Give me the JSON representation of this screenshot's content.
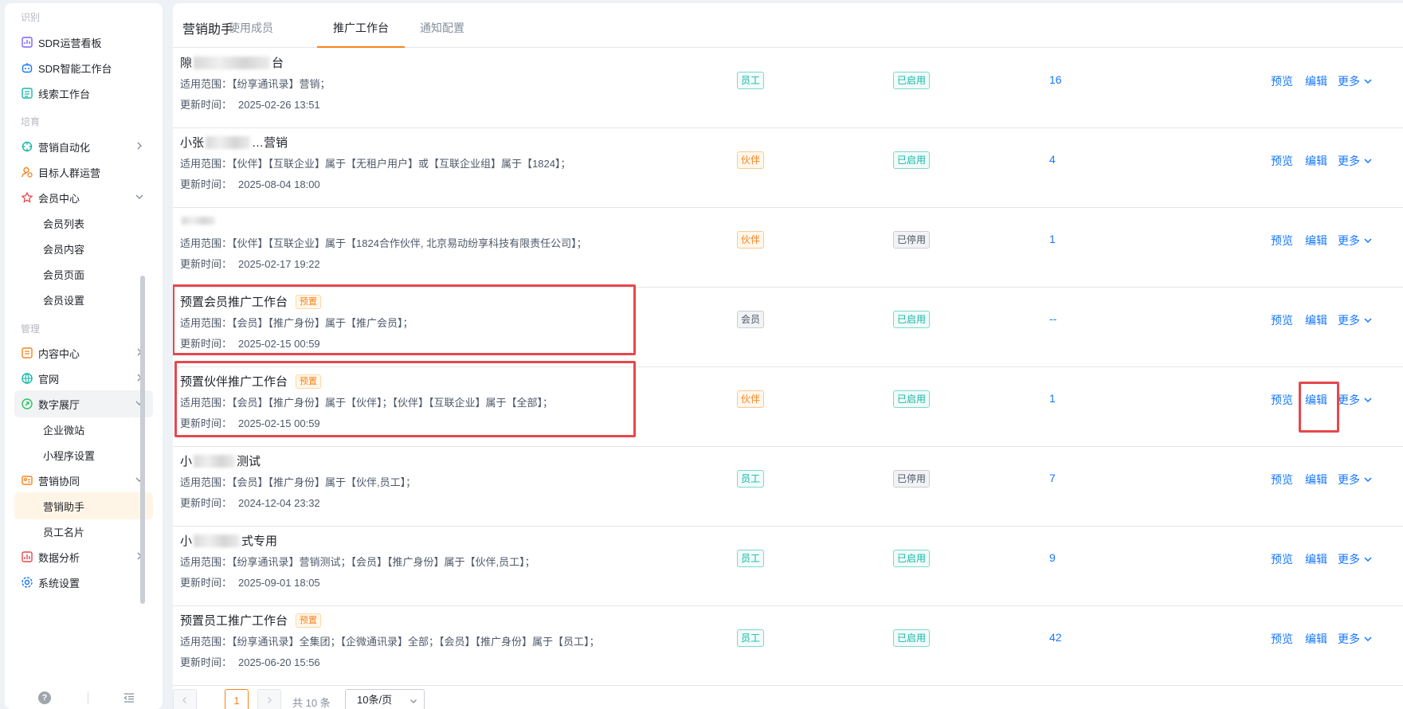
{
  "sidebar": {
    "sections": {
      "identify": "识别",
      "cultivate": "培育",
      "manage": "管理"
    },
    "items": {
      "sdr_dashboard": "SDR运营看板",
      "sdr_workbench": "SDR智能工作台",
      "lead_workbench": "线索工作台",
      "marketing_automation": "营销自动化",
      "target_audience": "目标人群运营",
      "member_center": "会员中心",
      "member_list": "会员列表",
      "member_content": "会员内容",
      "member_page": "会员页面",
      "member_settings": "会员设置",
      "content_center": "内容中心",
      "official_site": "官网",
      "digital_hall": "数字展厅",
      "enterprise_microsite": "企业微站",
      "mini_program_settings": "小程序设置",
      "marketing_collab": "营销协同",
      "marketing_assistant": "营销助手",
      "employee_card": "员工名片",
      "data_analysis": "数据分析",
      "system_settings": "系统设置"
    },
    "footer": {
      "help": "?"
    }
  },
  "header": {
    "title": "营销助手",
    "tabs": [
      "使用成员",
      "推广工作台",
      "通知配置"
    ],
    "active_tab": "推广工作台"
  },
  "rows": [
    {
      "title_a": "隙",
      "title_b": "台",
      "preset": "",
      "scope": "适用范围：【纷享通讯录】营销；",
      "updated_label": "更新时间：",
      "updated": "2025-02-26 13:51",
      "role": "员工",
      "status": "已启用",
      "count": "16"
    },
    {
      "title_a": "小张",
      "title_b": "…营销",
      "preset": "",
      "scope": "适用范围：【伙伴】【互联企业】属于【无租户用户】或【互联企业组】属于【1824】；",
      "updated_label": "更新时间：",
      "updated": "2025-08-04 18:00",
      "role": "伙伴",
      "status": "已启用",
      "count": "4"
    },
    {
      "title_a": "",
      "title_b": "",
      "preset": "",
      "scope": "适用范围：【伙伴】【互联企业】属于【1824合作伙伴, 北京易动纷享科技有限责任公司】；",
      "updated_label": "更新时间：",
      "updated": "2025-02-17 19:22",
      "role": "伙伴",
      "status": "已停用",
      "count": "1"
    },
    {
      "title": "预置会员推广工作台",
      "preset": "预置",
      "scope": "适用范围：【会员】【推广身份】属于【推广会员】；",
      "updated_label": "更新时间：",
      "updated": "2025-02-15 00:59",
      "role": "会员",
      "status": "已启用",
      "count": "--"
    },
    {
      "title": "预置伙伴推广工作台",
      "preset": "预置",
      "scope": "适用范围：【会员】【推广身份】属于【伙伴】；【伙伴】【互联企业】属于【全部】；",
      "updated_label": "更新时间：",
      "updated": "2025-02-15 00:59",
      "role": "伙伴",
      "status": "已启用",
      "count": "1"
    },
    {
      "title_a": "小",
      "title_b": "测试",
      "preset": "",
      "scope": "适用范围：【会员】【推广身份】属于【伙伴,员工】；",
      "updated_label": "更新时间：",
      "updated": "2024-12-04 23:32",
      "role": "员工",
      "status": "已停用",
      "count": "7"
    },
    {
      "title_a": "小",
      "title_b": "式专用",
      "preset": "",
      "scope": "适用范围：【纷享通讯录】营销测试；【会员】【推广身份】属于【伙伴,员工】；",
      "updated_label": "更新时间：",
      "updated": "2025-09-01 18:05",
      "role": "员工",
      "status": "已启用",
      "count": "9"
    },
    {
      "title": "预置员工推广工作台",
      "preset": "预置",
      "scope": "适用范围：【纷享通讯录】全集团；【企微通讯录】全部；【会员】【推广身份】属于【员工】；",
      "updated_label": "更新时间：",
      "updated": "2025-06-20 15:56",
      "role": "员工",
      "status": "已启用",
      "count": "42"
    }
  ],
  "actions": {
    "preview": "预览",
    "edit": "编辑",
    "more": "更多"
  },
  "pagination": {
    "current": "1",
    "total": "共 10 条",
    "page_size": "10条/页"
  },
  "colors": {
    "accent": "#f7831e",
    "link": "#1677ff",
    "highlight": "#e5484d",
    "enabled": "#14b8a6"
  }
}
